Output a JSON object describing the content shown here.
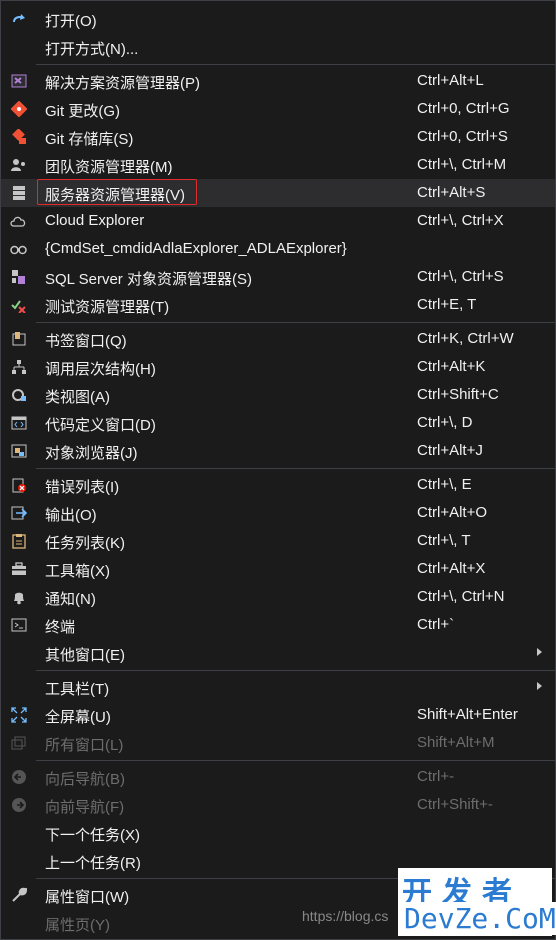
{
  "items": [
    {
      "label": "打开(O)",
      "shortcut": "",
      "icon": "open-redo-icon"
    },
    {
      "label": "打开方式(N)...",
      "shortcut": "",
      "icon": ""
    },
    {
      "label": "解决方案资源管理器(P)",
      "shortcut": "Ctrl+Alt+L",
      "icon": "solution-explorer-icon"
    },
    {
      "label": "Git 更改(G)",
      "shortcut": "Ctrl+0, Ctrl+G",
      "icon": "git-changes-icon"
    },
    {
      "label": "Git 存储库(S)",
      "shortcut": "Ctrl+0, Ctrl+S",
      "icon": "git-repository-icon"
    },
    {
      "label": "团队资源管理器(M)",
      "shortcut": "Ctrl+\\, Ctrl+M",
      "icon": "team-explorer-icon"
    },
    {
      "label": "服务器资源管理器(V)",
      "shortcut": "Ctrl+Alt+S",
      "icon": "server-explorer-icon"
    },
    {
      "label": "Cloud Explorer",
      "shortcut": "Ctrl+\\, Ctrl+X",
      "icon": "cloud-icon"
    },
    {
      "label": "{CmdSet_cmdidAdlaExplorer_ADLAExplorer}",
      "shortcut": "",
      "icon": "adla-explorer-icon"
    },
    {
      "label": "SQL Server 对象资源管理器(S)",
      "shortcut": "Ctrl+\\, Ctrl+S",
      "icon": "sql-server-icon"
    },
    {
      "label": "测试资源管理器(T)",
      "shortcut": "Ctrl+E, T",
      "icon": "test-explorer-icon"
    },
    {
      "label": "书签窗口(Q)",
      "shortcut": "Ctrl+K, Ctrl+W",
      "icon": "bookmark-icon"
    },
    {
      "label": "调用层次结构(H)",
      "shortcut": "Ctrl+Alt+K",
      "icon": "call-hierarchy-icon"
    },
    {
      "label": "类视图(A)",
      "shortcut": "Ctrl+Shift+C",
      "icon": "class-view-icon"
    },
    {
      "label": "代码定义窗口(D)",
      "shortcut": "Ctrl+\\, D",
      "icon": "code-definition-icon"
    },
    {
      "label": "对象浏览器(J)",
      "shortcut": "Ctrl+Alt+J",
      "icon": "object-browser-icon"
    },
    {
      "label": "错误列表(I)",
      "shortcut": "Ctrl+\\, E",
      "icon": "error-list-icon"
    },
    {
      "label": "输出(O)",
      "shortcut": "Ctrl+Alt+O",
      "icon": "output-icon"
    },
    {
      "label": "任务列表(K)",
      "shortcut": "Ctrl+\\, T",
      "icon": "task-list-icon"
    },
    {
      "label": "工具箱(X)",
      "shortcut": "Ctrl+Alt+X",
      "icon": "toolbox-icon"
    },
    {
      "label": "通知(N)",
      "shortcut": "Ctrl+\\, Ctrl+N",
      "icon": "notification-bell-icon"
    },
    {
      "label": "终端",
      "shortcut": "Ctrl+`",
      "icon": "terminal-icon"
    },
    {
      "label": "其他窗口(E)",
      "shortcut": "",
      "icon": ""
    },
    {
      "label": "工具栏(T)",
      "shortcut": "",
      "icon": ""
    },
    {
      "label": "全屏幕(U)",
      "shortcut": "Shift+Alt+Enter",
      "icon": "fullscreen-icon"
    },
    {
      "label": "所有窗口(L)",
      "shortcut": "Shift+Alt+M",
      "icon": "all-windows-icon"
    },
    {
      "label": "向后导航(B)",
      "shortcut": "Ctrl+-",
      "icon": "navigate-back-icon"
    },
    {
      "label": "向前导航(F)",
      "shortcut": "Ctrl+Shift+-",
      "icon": "navigate-forward-icon"
    },
    {
      "label": "下一个任务(X)",
      "shortcut": "",
      "icon": ""
    },
    {
      "label": "上一个任务(R)",
      "shortcut": "",
      "icon": ""
    },
    {
      "label": "属性窗口(W)",
      "shortcut": "",
      "icon": "wrench-icon"
    },
    {
      "label": "属性页(Y)",
      "shortcut": "",
      "icon": ""
    }
  ],
  "watermark": "https://blog.cs",
  "logo": {
    "line1": "开发者",
    "line2": "DevZe.CoM"
  },
  "colors": {
    "background": "#1b1b1c",
    "highlight_border": "#e02b2b",
    "selected_row": "#2d2d30",
    "logo": "#2a7bd1"
  }
}
